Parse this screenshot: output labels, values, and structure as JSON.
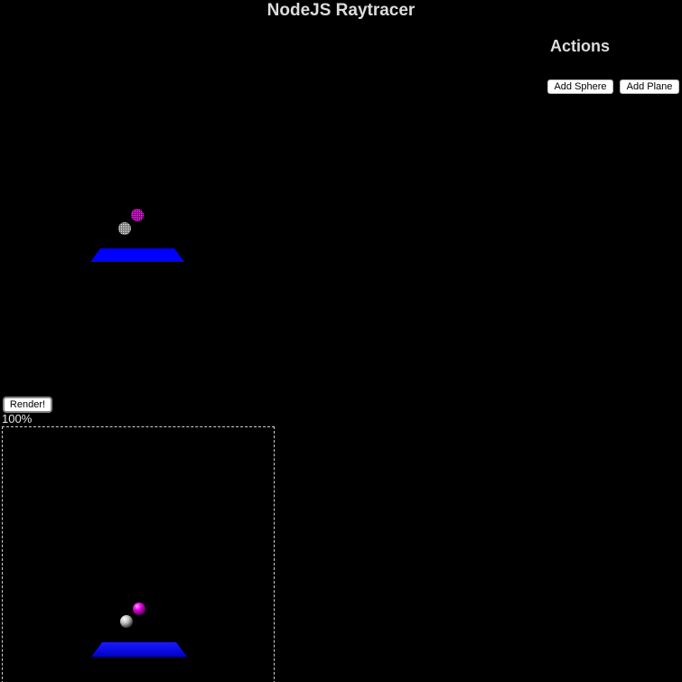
{
  "app": {
    "title": "NodeJS Raytracer"
  },
  "actions": {
    "heading": "Actions",
    "add_sphere_label": "Add Sphere",
    "add_plane_label": "Add Plane"
  },
  "render": {
    "button_label": "Render!",
    "progress_text": "100%"
  },
  "scene": {
    "colors": {
      "plane": "#0000ff",
      "sphere_magenta": "#cc00cc",
      "sphere_white": "#ffffff",
      "background": "#000000"
    }
  }
}
